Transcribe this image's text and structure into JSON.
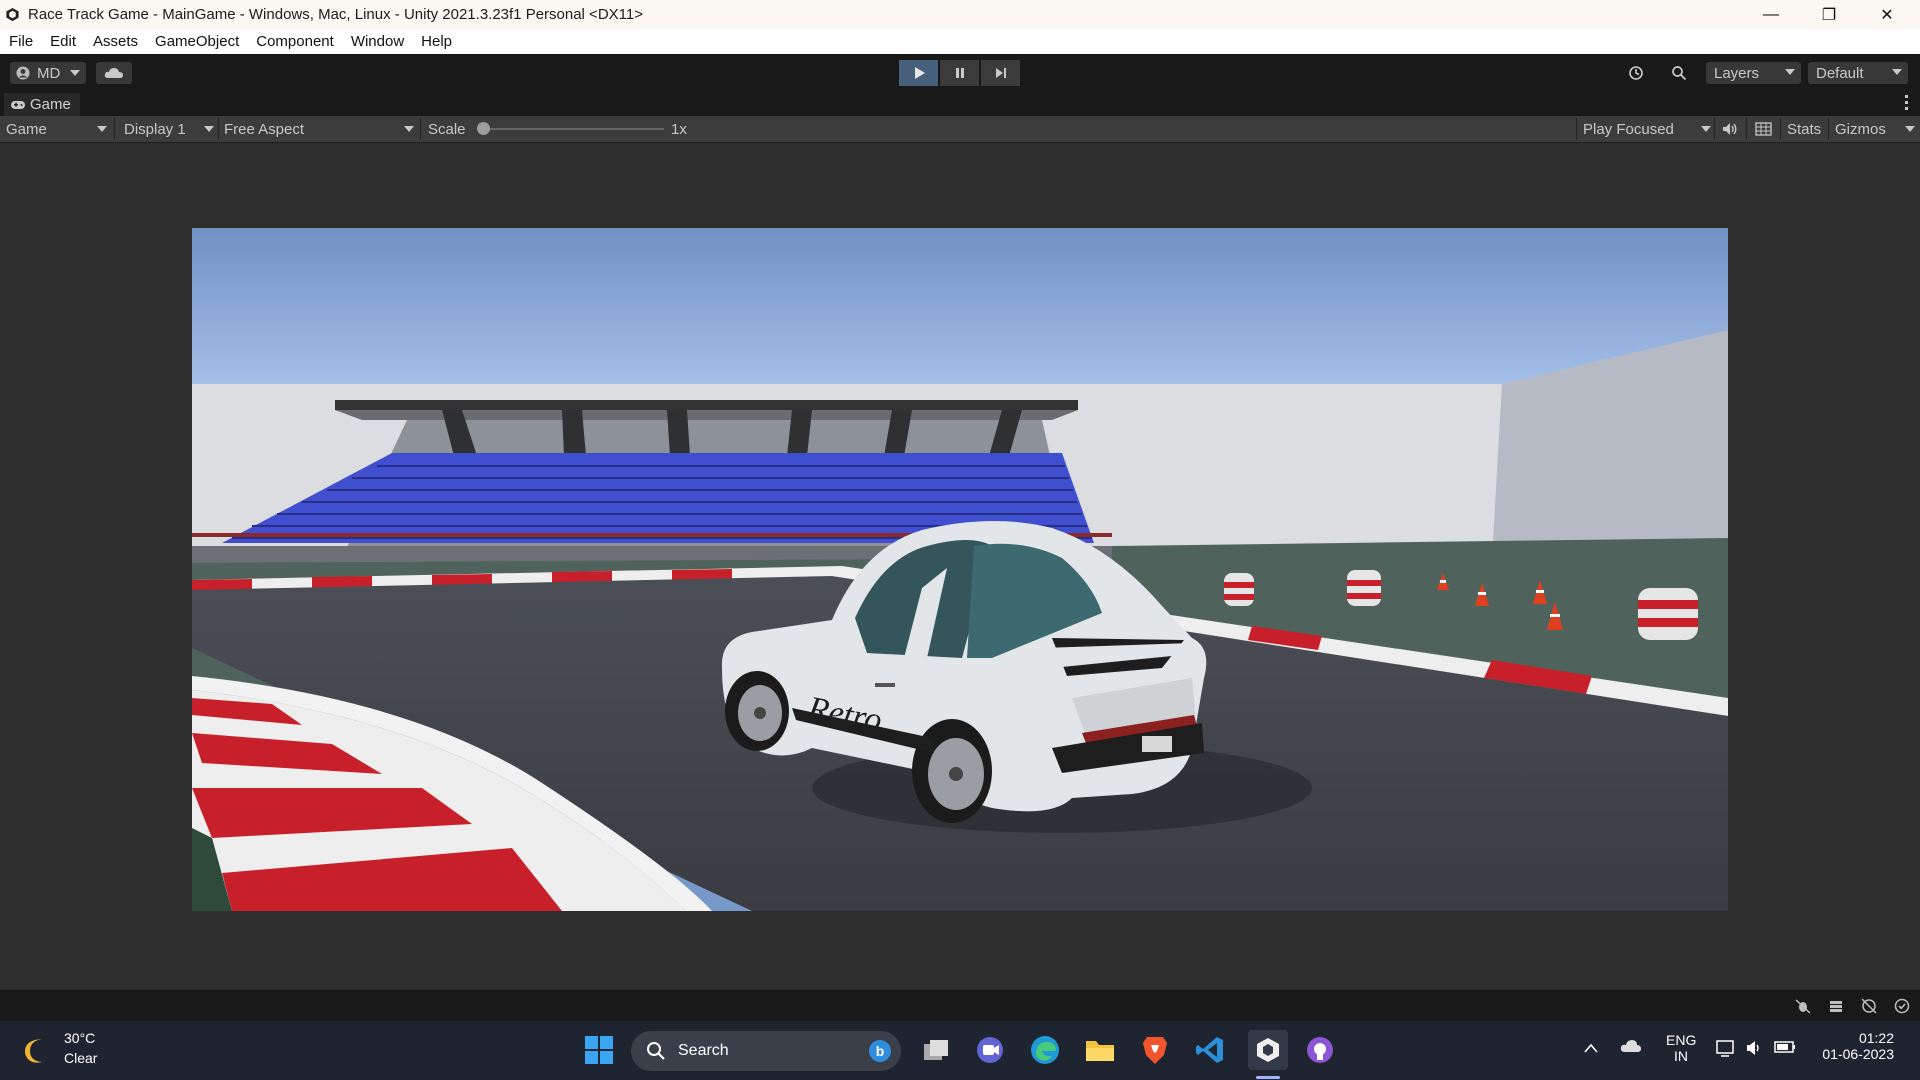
{
  "window": {
    "title": "Race Track Game - MainGame - Windows, Mac, Linux - Unity 2021.3.23f1 Personal <DX11>",
    "minimize_glyph": "—",
    "restore_glyph": "❐",
    "close_glyph": "✕"
  },
  "menu": [
    "File",
    "Edit",
    "Assets",
    "GameObject",
    "Component",
    "Window",
    "Help"
  ],
  "toolbar": {
    "account_label": "MD",
    "layers_label": "Layers",
    "layout_label": "Default",
    "play_state": "playing"
  },
  "game_tab": {
    "label": "Game",
    "view_dropdown": "Game",
    "display_dropdown": "Display 1",
    "aspect_dropdown": "Free Aspect",
    "scale_label": "Scale",
    "scale_value": "1x",
    "scale_fraction": 0.0,
    "play_focused": "Play Focused",
    "stats_label": "Stats",
    "gizmos_label": "Gizmos"
  },
  "scene": {
    "car_text": "Retro",
    "sky_color": "#7799c9",
    "seat_color": "#3f4fd0",
    "kerb_red": "#c8202a"
  },
  "taskbar": {
    "weather_temp": "30°C",
    "weather_desc": "Clear",
    "search_placeholder": "Search",
    "lang_line1": "ENG",
    "lang_line2": "IN",
    "time": "01:22",
    "date": "01-06-2023"
  }
}
